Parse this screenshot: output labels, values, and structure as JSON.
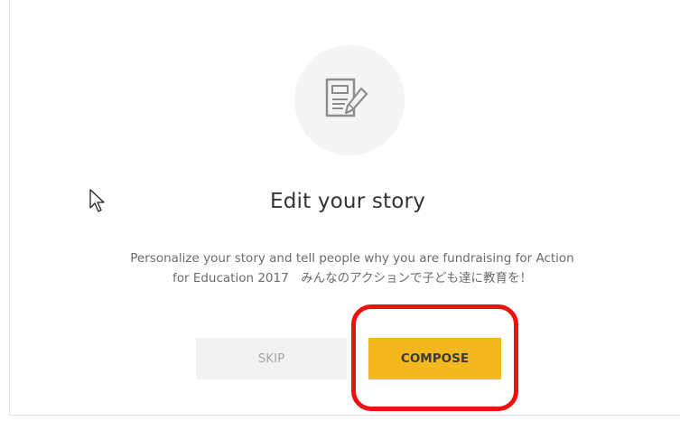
{
  "dialog": {
    "icon": "compose-document-icon",
    "title": "Edit your story",
    "description_line1": "Personalize your story and tell people why you are fundraising for Action",
    "description_line2": "for Education 2017　みんなのアクションで子ども達に教育を！",
    "skip_label": "SKIP",
    "compose_label": "COMPOSE"
  },
  "colors": {
    "accent": "#f3b81e",
    "skip_bg": "#f2f2f2",
    "highlight": "#ee1111"
  }
}
